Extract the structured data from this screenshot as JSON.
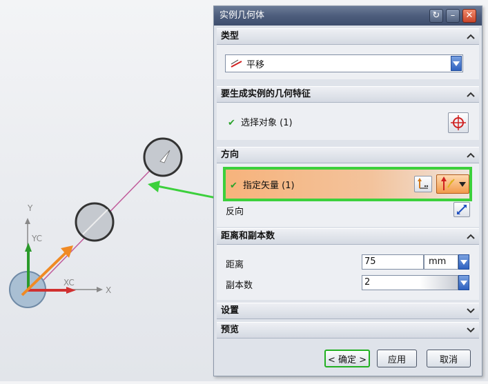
{
  "dialog": {
    "title": "实例几何体",
    "sections": {
      "type": {
        "header": "类型",
        "selected": "平移"
      },
      "features": {
        "header": "要生成实例的几何特征",
        "select_label": "选择对象 (1)"
      },
      "direction": {
        "header": "方向",
        "vector_label": "指定矢量 (1)",
        "reverse_label": "反向"
      },
      "distance": {
        "header": "距离和副本数",
        "distance_label": "距离",
        "distance_value": "75",
        "distance_unit": "mm",
        "copies_label": "副本数",
        "copies_value": "2"
      },
      "settings": {
        "header": "设置"
      },
      "preview": {
        "header": "预览"
      }
    },
    "buttons": {
      "ok": "< 确定 >",
      "apply": "应用",
      "cancel": "取消"
    }
  },
  "viewport": {
    "axis_labels": {
      "y": "Y",
      "yc": "YC",
      "xc": "XC",
      "x": "X"
    }
  },
  "colors": {
    "highlight_border": "#3cd03c",
    "vector_orange": "#f08a24",
    "titlebar": "#4d5d7c"
  }
}
